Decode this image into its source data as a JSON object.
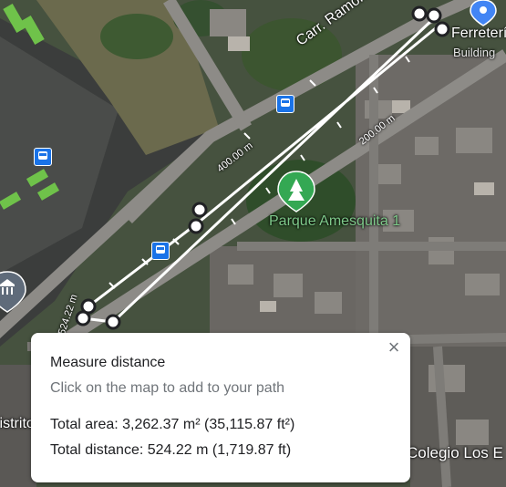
{
  "map": {
    "street_label": "Carr. Ramón Matías Mella",
    "poi_label": "Parque Amesquita 1",
    "place_top_right": "Ferretería",
    "place_top_right_sub": "Building",
    "place_bottom_right": "Colegio Los E",
    "place_bottom_left": "Distrito",
    "segment_labels": [
      "400.00 m",
      "200.00 m",
      "524.22 m"
    ],
    "icons": [
      "bus-stop-icon",
      "park-tree-pin-icon",
      "museum-pin-icon",
      "location-pin-icon"
    ]
  },
  "measure": {
    "title": "Measure distance",
    "hint": "Click on the map to add to your path",
    "area_text": "Total area: 3,262.37 m² (35,115.87 ft²)",
    "distance_text": "Total distance: 524.22 m (1,719.87 ft)",
    "close_symbol": "×"
  },
  "colors": {
    "measure_line": "#ffffff",
    "poi_green": "#34a853",
    "bus_blue": "#1a73e8"
  }
}
